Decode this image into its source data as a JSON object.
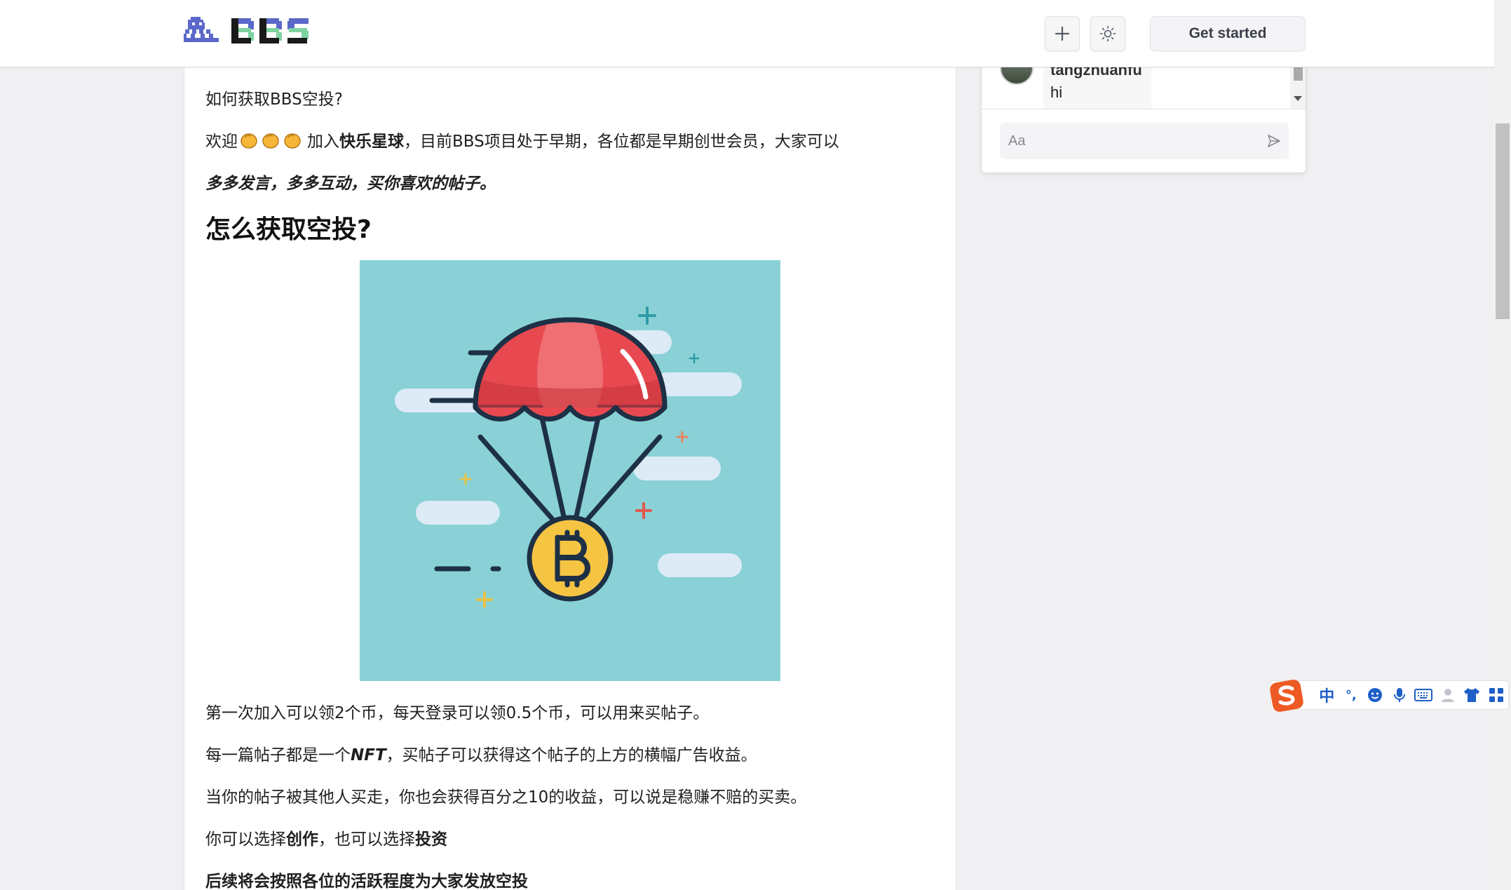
{
  "header": {
    "logo_text": "BBS",
    "plus_icon": "plus-icon",
    "theme_icon": "sun-icon",
    "get_started_label": "Get started"
  },
  "article": {
    "line1": "如何获取BBS空投?",
    "line2_prefix": "欢迎",
    "line2_join": "加入",
    "line2_bold": "快乐星球",
    "line2_suffix": "，目前BBS项目处于早期，各位都是早期创世会员，大家可以",
    "line3": "多多发言，多多互动，买你喜欢的帖子。",
    "heading": "怎么获取空投?",
    "image_icon": "parachute-bitcoin-airdrop-illustration",
    "p1": "第一次加入可以领2个币，每天登录可以领0.5个币，可以用来买帖子。",
    "p2_prefix": "每一篇帖子都是一个",
    "p2_em": "NFT",
    "p2_suffix": "，买帖子可以获得这个帖子的上方的横幅广告收益。",
    "p3": "当你的帖子被其他人买走，你也会获得百分之10的收益，可以说是稳赚不赔的买卖。",
    "p4_prefix": "你可以选择",
    "p4_bold1": "创作",
    "p4_mid": "，也可以选择",
    "p4_bold2": "投资",
    "p5": "后续将会按照各位的活跃程度为大家发放空投"
  },
  "chat": {
    "author": "tangzhuanfu",
    "message": "hi",
    "input_placeholder": "Aa",
    "send_icon": "send-icon"
  },
  "ime": {
    "logo": "sogou-s-icon",
    "lang": "中",
    "punct": "°,",
    "items": [
      "emoji-icon",
      "microphone-icon",
      "keyboard-icon",
      "user-icon",
      "shirt-icon",
      "grid-icon"
    ]
  },
  "colors": {
    "accent_blue": "#5b68c9",
    "accent_green": "#7fd3a2",
    "image_bg": "#89d1d6",
    "parachute_red": "#e8484f",
    "coin_yellow": "#f5c443"
  }
}
